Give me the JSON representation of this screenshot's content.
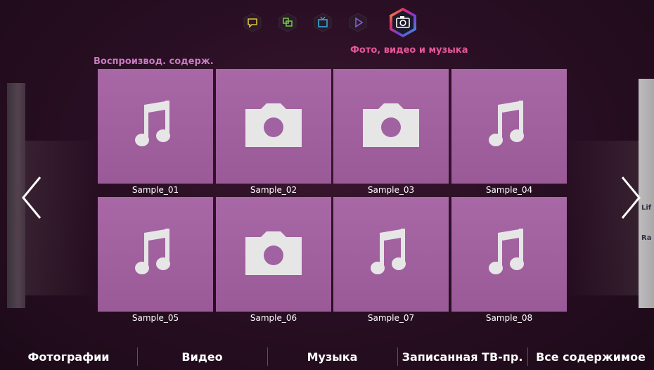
{
  "panels": {
    "active_title": "Фото, видео и музыка",
    "left_title": "Воспроизвод. содерж.",
    "icons": [
      "chat-icon",
      "multi-screen-icon",
      "tv-icon",
      "play-icon",
      "camera-icon"
    ]
  },
  "tiles": [
    {
      "label": "Sample_01",
      "type": "music"
    },
    {
      "label": "Sample_02",
      "type": "photo"
    },
    {
      "label": "Sample_03",
      "type": "photo"
    },
    {
      "label": "Sample_04",
      "type": "music"
    },
    {
      "label": "Sample_05",
      "type": "music"
    },
    {
      "label": "Sample_06",
      "type": "photo"
    },
    {
      "label": "Sample_07",
      "type": "music"
    },
    {
      "label": "Sample_08",
      "type": "music"
    }
  ],
  "bottom_nav": [
    "Фотографии",
    "Видео",
    "Музыка",
    "Записанная ТВ-пр.",
    "Все содержимое"
  ],
  "right_peek": [
    "Lif",
    "Ra"
  ],
  "colors": {
    "accent": "#e6569a",
    "tile": "#a868a6",
    "background": "#2a0f24"
  }
}
